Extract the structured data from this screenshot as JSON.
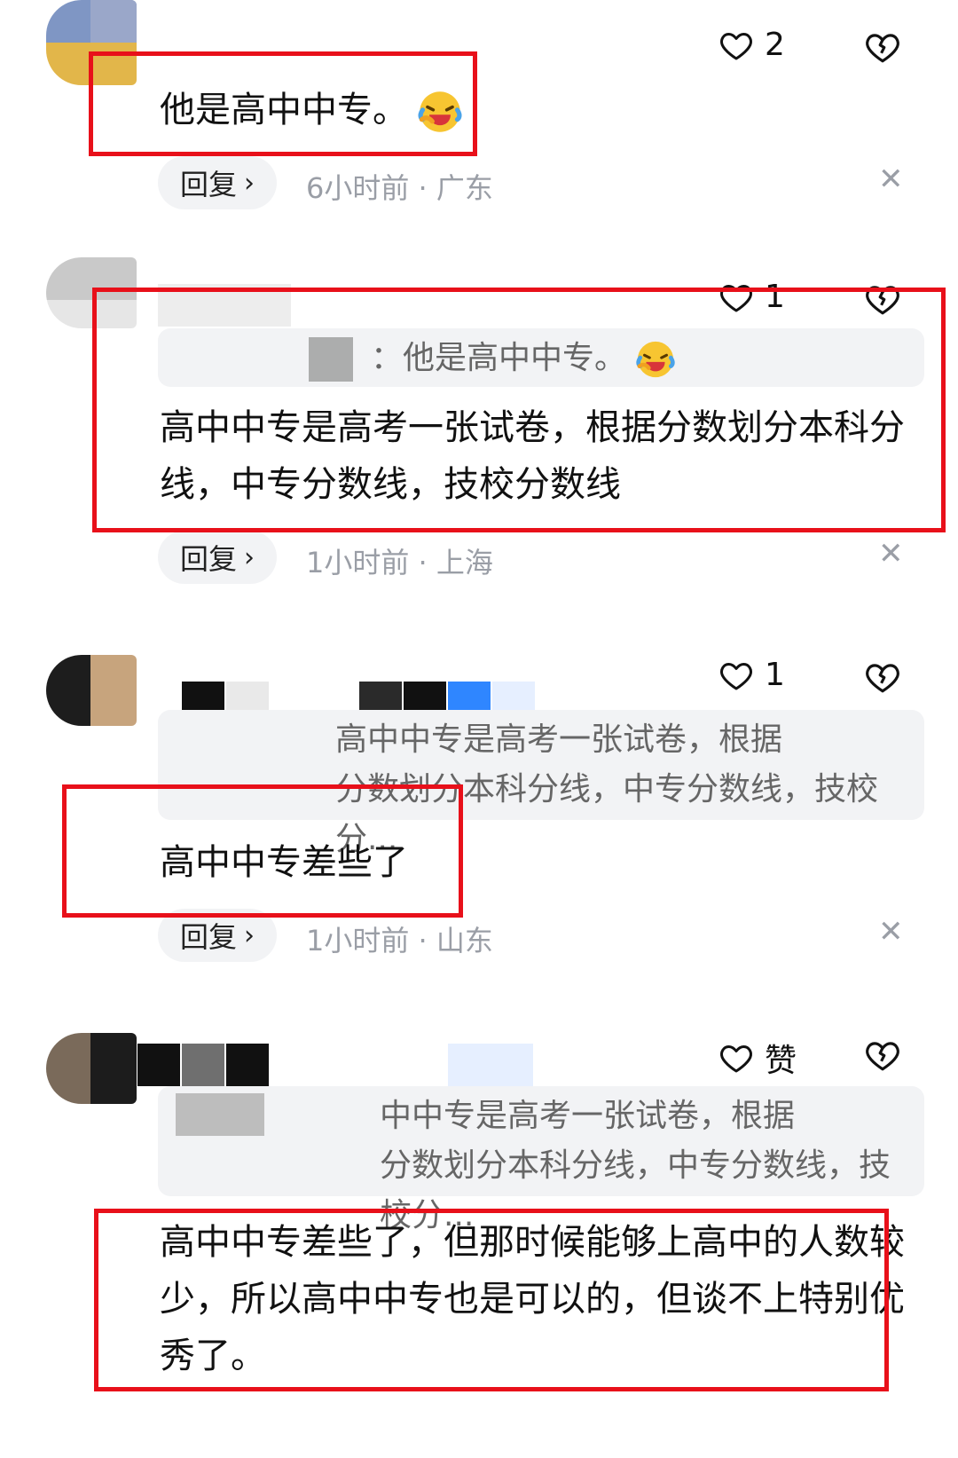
{
  "comments": [
    {
      "likes": "2",
      "text": "他是高中中专。",
      "reply_label": "回复",
      "meta": "6小时前 · 广东"
    },
    {
      "likes": "1",
      "quote": "：他是高中中专。",
      "text": "高中中专是高考一张试卷，根据分数划分本科分线，中专分数线，技校分数线",
      "reply_label": "回复",
      "meta": "1小时前 · 上海"
    },
    {
      "likes": "1",
      "quote": "高中中专是高考一张试卷，根据\n分数划分本科分线，中专分数线，技校分...",
      "text": "高中中专差些了",
      "reply_label": "回复",
      "meta": "1小时前 · 山东"
    },
    {
      "likes": "赞",
      "quote": "中中专是高考一张试卷，根据\n分数划分本科分线，中专分数线，技校分...",
      "text": "高中中专差些了，但那时候能够上高中的人数较少，所以高中中专也是可以的，但谈不上特别优秀了。"
    }
  ],
  "icons": {
    "like": "heart-outline-icon",
    "dislike": "broken-heart-icon",
    "close": "close-icon",
    "emoji": "laughing-crying-emoji"
  },
  "colors": {
    "highlight_box": "#e8101a",
    "meta_text": "#9a9ea6",
    "quote_bg": "#f2f3f5"
  }
}
